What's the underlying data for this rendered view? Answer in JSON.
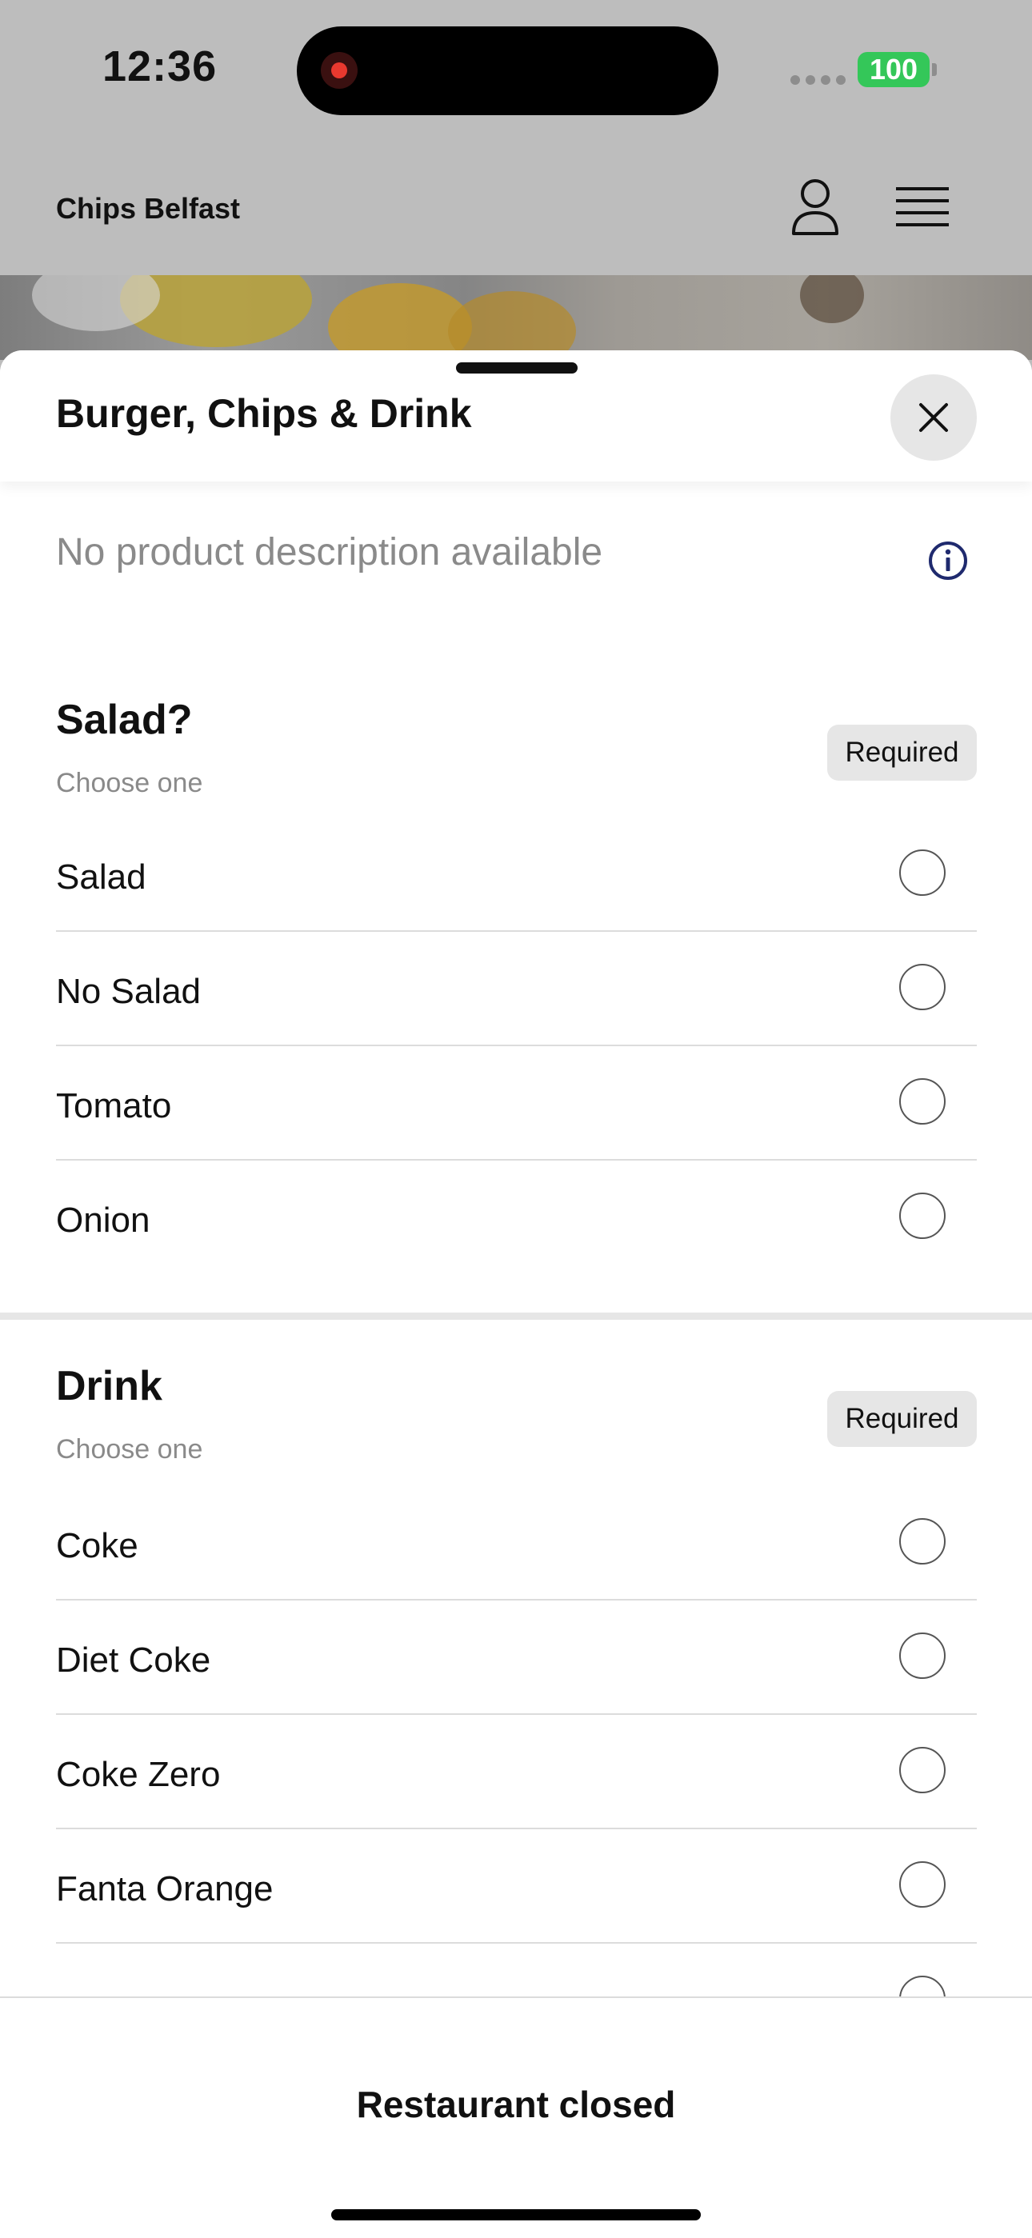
{
  "status_bar": {
    "time": "12:36",
    "battery": "100",
    "recording": true
  },
  "header": {
    "brand": "Chips Belfast"
  },
  "colors": {
    "battery": "#34c759",
    "info_icon": "#1f2a6e",
    "recording": "#e8392f",
    "overlay": "#bdbdbd"
  },
  "icons": {
    "user": "user-icon",
    "menu": "hamburger-menu-icon",
    "close": "close-icon",
    "info": "info-icon"
  },
  "sheet": {
    "title": "Burger, Chips & Drink",
    "description": "No product description available",
    "groups": [
      {
        "title": "Salad?",
        "subtitle": "Choose one",
        "badge": "Required",
        "options": [
          {
            "label": "Salad",
            "selected": false
          },
          {
            "label": "No Salad",
            "selected": false
          },
          {
            "label": "Tomato",
            "selected": false
          },
          {
            "label": "Onion",
            "selected": false
          }
        ]
      },
      {
        "title": "Drink",
        "subtitle": "Choose one",
        "badge": "Required",
        "options": [
          {
            "label": "Coke",
            "selected": false
          },
          {
            "label": "Diet Coke",
            "selected": false
          },
          {
            "label": "Coke Zero",
            "selected": false
          },
          {
            "label": "Fanta Orange",
            "selected": false
          }
        ]
      }
    ]
  },
  "footer": {
    "status": "Restaurant closed"
  }
}
